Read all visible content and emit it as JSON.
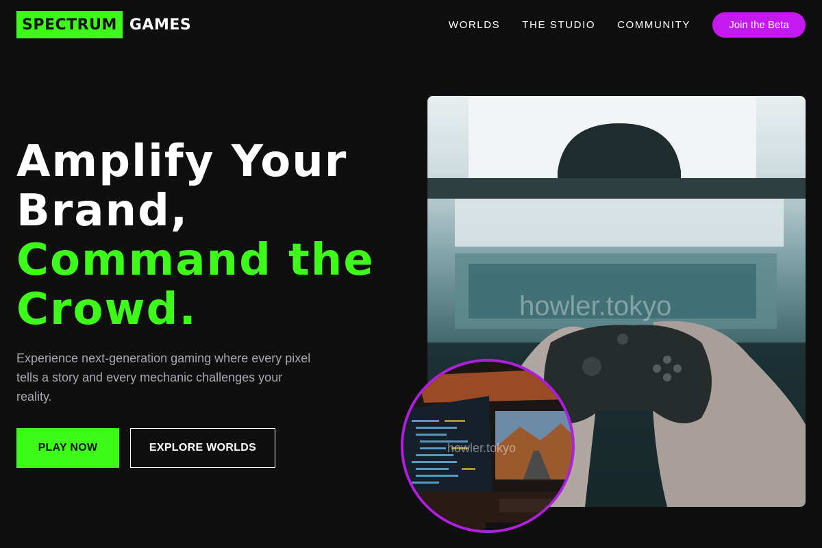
{
  "brand": {
    "logo_highlight": "SPECTRUM",
    "logo_rest": "GAMES",
    "accent_green": "#3dfc1a",
    "accent_purple": "#c41af0"
  },
  "nav": {
    "items": [
      {
        "label": "WORLDS"
      },
      {
        "label": "THE STUDIO"
      },
      {
        "label": "COMMUNITY"
      }
    ],
    "cta_label": "Join the Beta"
  },
  "hero": {
    "headline_lines": [
      "Amplify Your",
      "Brand,"
    ],
    "headline_accent_lines": [
      "Command the",
      "Crowd."
    ],
    "subtext": "Experience next-generation gaming where every pixel tells a story and every mechanic challenges your reality.",
    "primary_button": "PLAY NOW",
    "secondary_button": "EXPLORE WORLDS"
  },
  "media": {
    "main_image": "person holding game controller",
    "main_watermark": "howler.tokyo",
    "circle_image": "desk setup with code monitors",
    "circle_watermark": "howler.tokyo"
  }
}
